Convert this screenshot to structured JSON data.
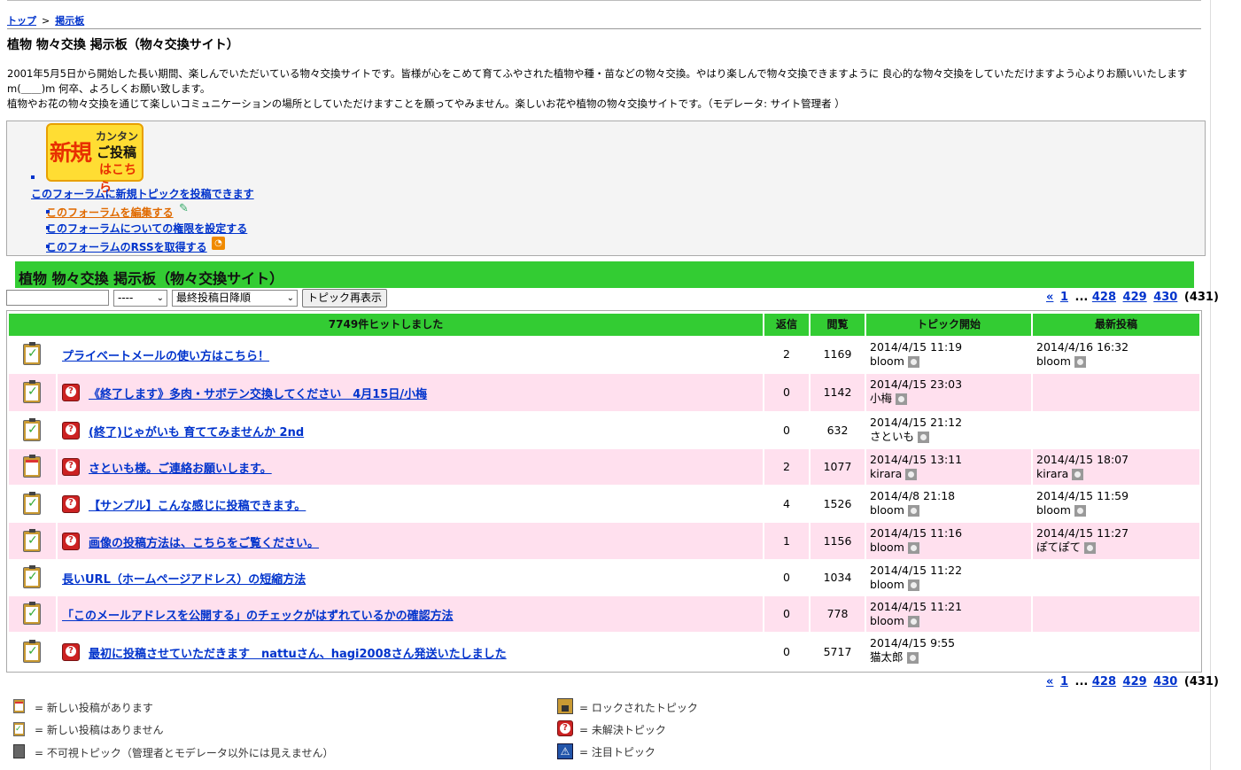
{
  "breadcrumb": {
    "top": "トップ",
    "sep": ">",
    "board": "掲示板"
  },
  "page_title": "植物 物々交換 掲示板（物々交換サイト）",
  "description": [
    "2001年5月5日から開始した長い期間、楽しんでいただいている物々交換サイトです。皆様が心をこめて育てふやされた植物や種・苗などの物々交換。やはり楽しんで物々交換できますように 良心的な物々交換をしていただけますよう心よりお願いいたしますm(＿＿)m 何卒、よろしくお願い致します。",
    "植物やお花の物々交換を通じて楽しいコミュニケーションの場所としていただけますことを願ってやみません。楽しいお花や植物の物々交換サイトです。（モデレータ: サイト管理者 ）"
  ],
  "newpost_banner": {
    "big": "新規",
    "small1": "カンタン",
    "small2": "ご投稿",
    "small3": "はこちら"
  },
  "tools": {
    "new_topic": "このフォーラムに新規トピックを投稿できます",
    "edit_forum": "このフォーラムを編集する",
    "permissions": "このフォーラムについての権限を設定する",
    "rss": "このフォーラムのRSSを取得する",
    "rss_icon": "rss-icon"
  },
  "forum_title": "植物 物々交換 掲示板（物々交換サイト）",
  "filter": {
    "search_value": "",
    "period_value": "----",
    "sort_value": "最終投稿日降順",
    "button": "トピック再表示"
  },
  "pager": {
    "prev": "«",
    "p1": "1",
    "dots": "...",
    "p428": "428",
    "p429": "429",
    "p430": "430",
    "total": "(431)"
  },
  "table": {
    "headers": {
      "topic": "7749件ヒットしました",
      "replies": "返信",
      "views": "閲覧",
      "started": "トピック開始",
      "latest": "最新投稿"
    },
    "rows": [
      {
        "title": "プライベートメールの使い方はこちら！",
        "replies": "2",
        "views": "1169",
        "start_date": "2014/4/15 11:19",
        "start_user": "bloom",
        "last_date": "2014/4/16 16:32",
        "last_user": "bloom",
        "unsolved": false,
        "new_posts": false
      },
      {
        "title": "《終了します》多肉・サボテン交換してください　4月15日/小梅",
        "replies": "0",
        "views": "1142",
        "start_date": "2014/4/15 23:03",
        "start_user": "小梅",
        "last_date": "",
        "last_user": "",
        "unsolved": true,
        "new_posts": false
      },
      {
        "title": "(終了)じゃがいも 育ててみませんか 2nd",
        "replies": "0",
        "views": "632",
        "start_date": "2014/4/15 21:12",
        "start_user": "さといも",
        "last_date": "",
        "last_user": "",
        "unsolved": true,
        "new_posts": false
      },
      {
        "title": "さといも様。ご連絡お願いします。",
        "replies": "2",
        "views": "1077",
        "start_date": "2014/4/15 13:11",
        "start_user": "kirara",
        "last_date": "2014/4/15 18:07",
        "last_user": "kirara",
        "unsolved": true,
        "new_posts": true
      },
      {
        "title": "【サンプル】こんな感じに投稿できます。",
        "replies": "4",
        "views": "1526",
        "start_date": "2014/4/8 21:18",
        "start_user": "bloom",
        "last_date": "2014/4/15 11:59",
        "last_user": "bloom",
        "unsolved": true,
        "new_posts": false
      },
      {
        "title": "画像の投稿方法は、こちらをご覧ください。",
        "replies": "1",
        "views": "1156",
        "start_date": "2014/4/15 11:16",
        "start_user": "bloom",
        "last_date": "2014/4/15 11:27",
        "last_user": "ぽてぽて",
        "unsolved": true,
        "new_posts": false
      },
      {
        "title": "長いURL（ホームページアドレス）の短縮方法",
        "replies": "0",
        "views": "1034",
        "start_date": "2014/4/15 11:22",
        "start_user": "bloom",
        "last_date": "",
        "last_user": "",
        "unsolved": false,
        "new_posts": false
      },
      {
        "title": "「このメールアドレスを公開する」のチェックがはずれているかの確認方法",
        "replies": "0",
        "views": "778",
        "start_date": "2014/4/15 11:21",
        "start_user": "bloom",
        "last_date": "",
        "last_user": "",
        "unsolved": false,
        "new_posts": false
      },
      {
        "title": "最初に投稿させていただきます　nattuさん、hagi2008さん発送いたしました",
        "replies": "0",
        "views": "5717",
        "start_date": "2014/4/15 9:55",
        "start_user": "猫太郎",
        "last_date": "",
        "last_user": "",
        "unsolved": true,
        "new_posts": false
      }
    ]
  },
  "legend": {
    "new_posts": "= 新しい投稿があります",
    "no_new_posts": "= 新しい投稿はありません",
    "invisible": "= 不可視トピック（管理者とモデレータ以外には見えません）",
    "locked": "= ロックされたトピック",
    "unsolved": "= 未解決トピック",
    "sticky": "= 注目トピック"
  },
  "colors": {
    "header_green": "#33cc33",
    "row_pink": "#ffe0ee",
    "link_blue": "#0033cc",
    "edit_orange": "#e06a00"
  }
}
